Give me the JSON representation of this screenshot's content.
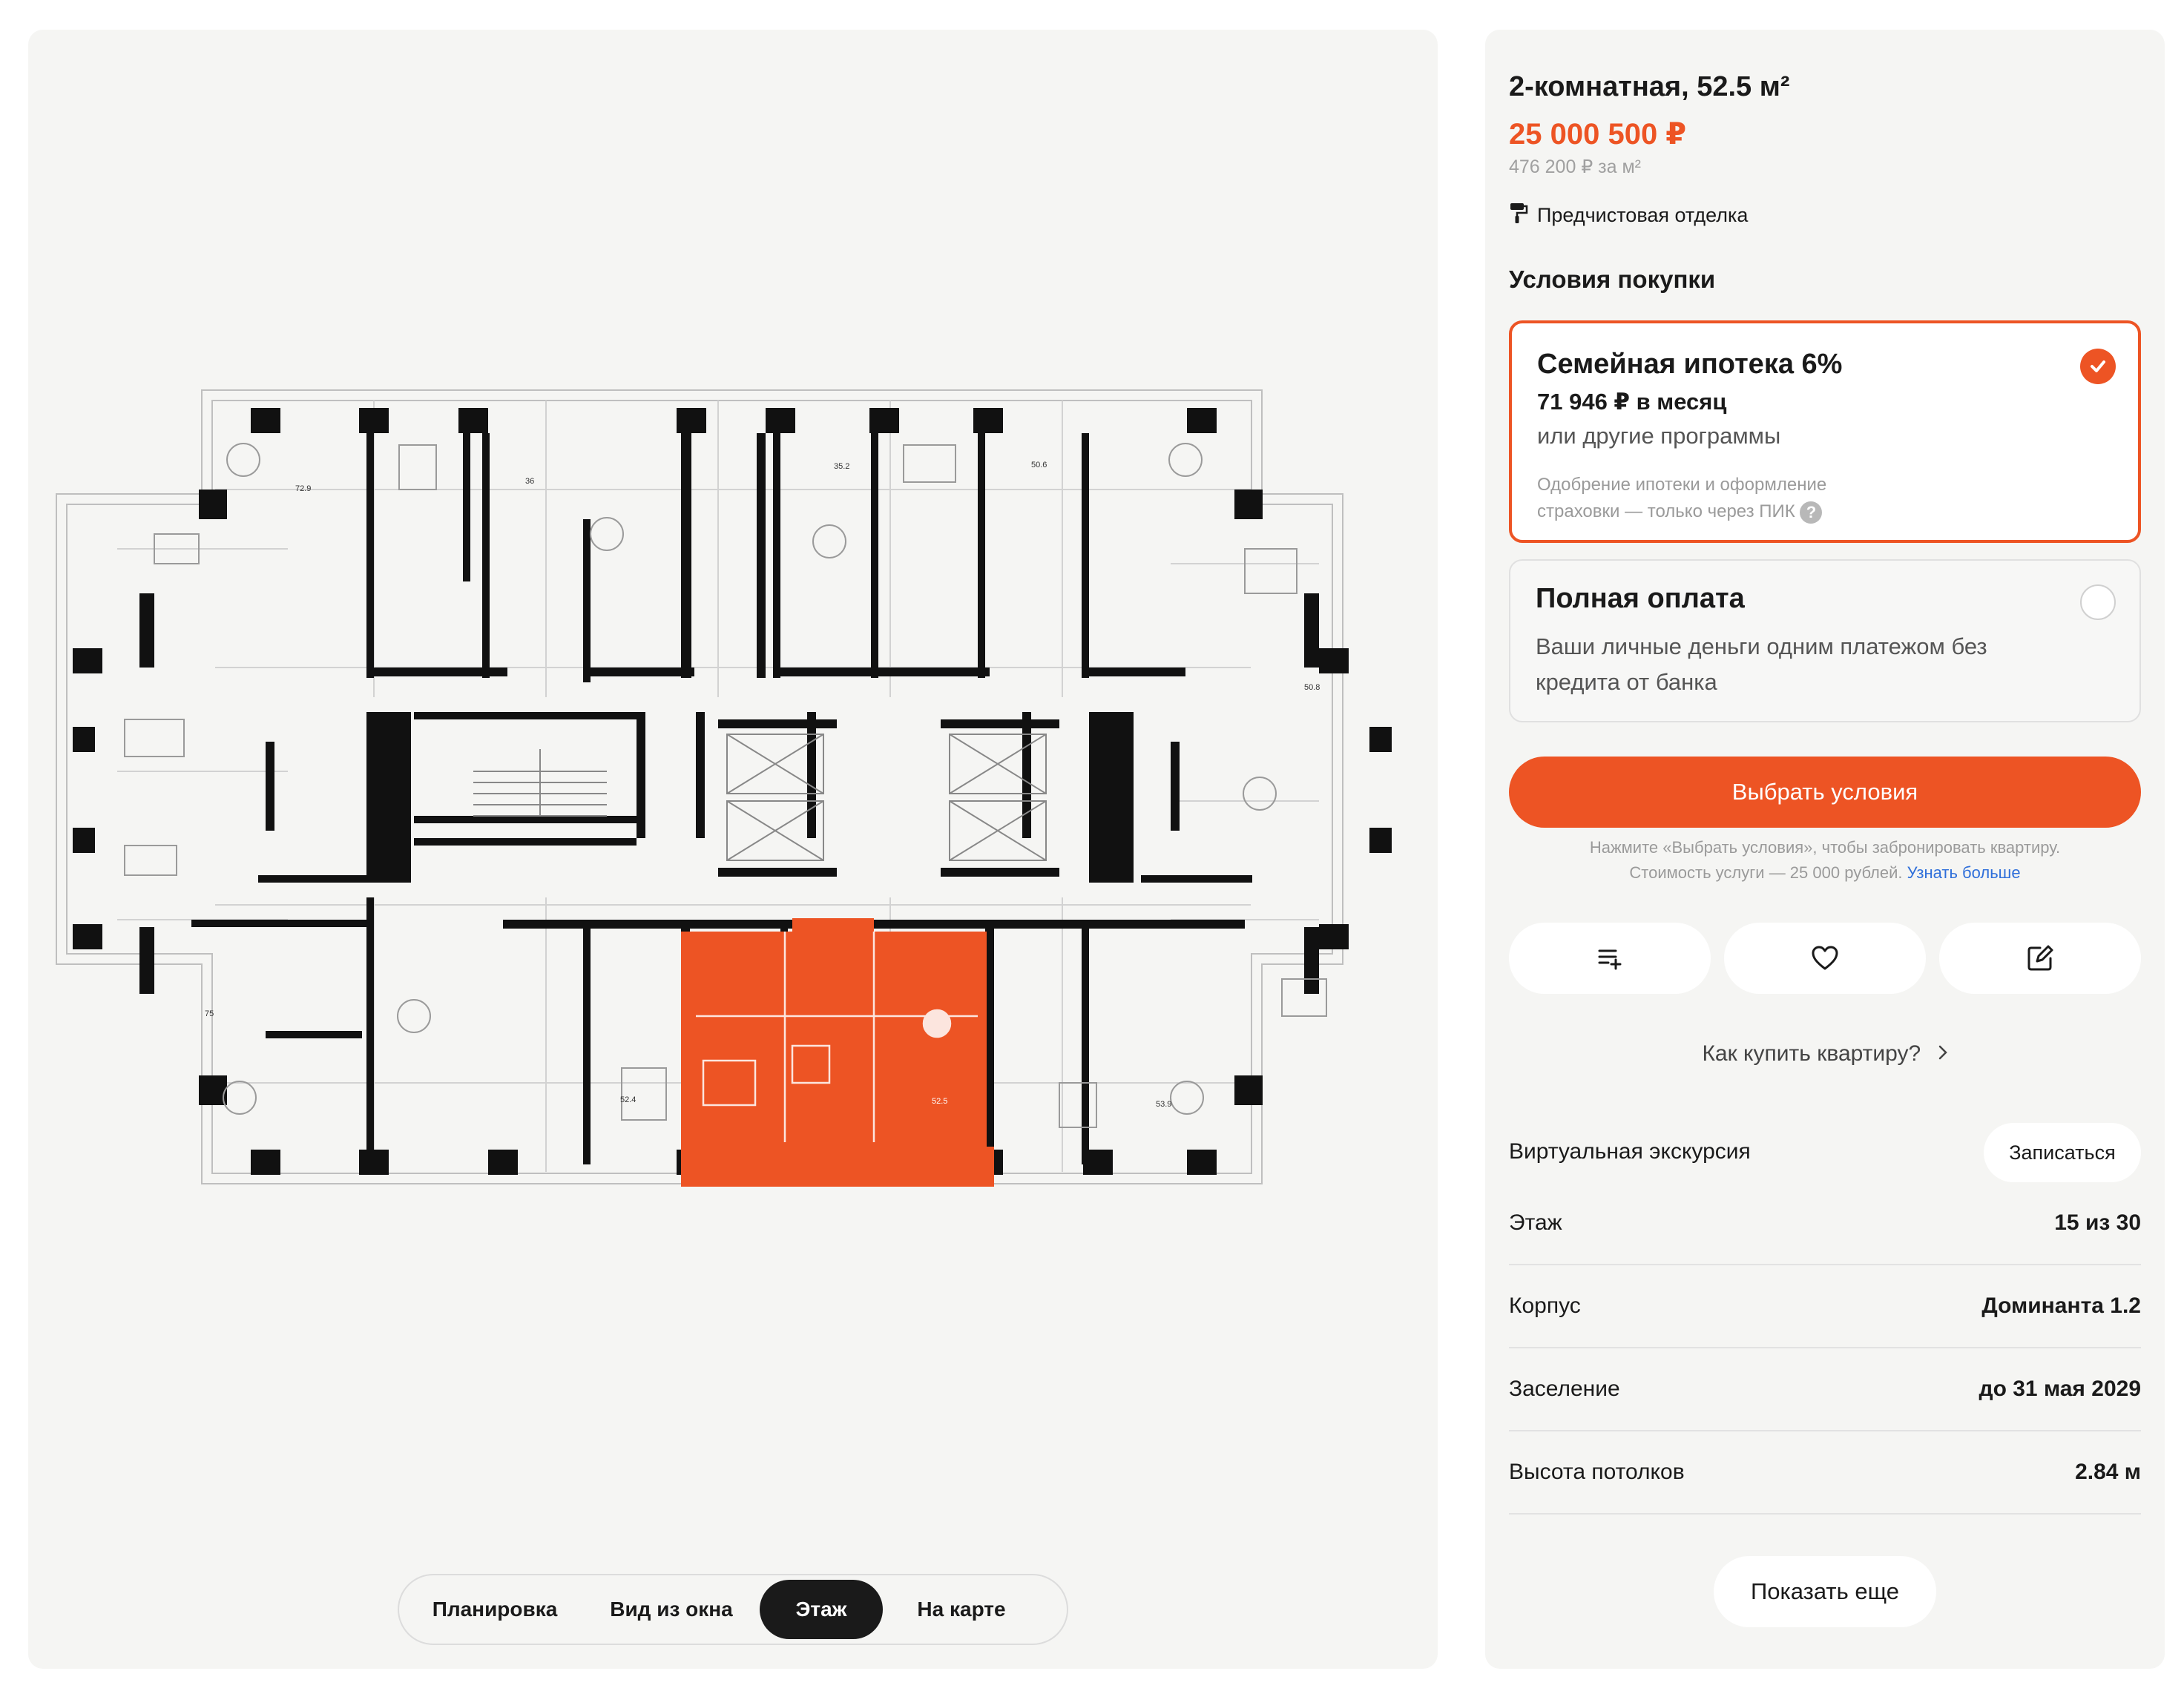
{
  "apartment": {
    "title": "2-комнатная, 52.5 м²",
    "price": "25 000 500 ₽",
    "price_per_m2": "476 200 ₽ за м²",
    "finish": "Предчистовая отделка",
    "finish_icon": "paint-roller-icon"
  },
  "purchase": {
    "heading": "Условия покупки",
    "options": [
      {
        "title": "Семейная ипотека 6%",
        "monthly": "71 946 ₽ в месяц",
        "other": "или другие программы",
        "note_line1": "Одобрение ипотеки и оформление",
        "note_line2": "страховки — только через ПИК",
        "help": "?",
        "selected": true
      },
      {
        "title": "Полная оплата",
        "desc_line1": "Ваши личные деньги одним платежом без",
        "desc_line2": "кредита от банка",
        "selected": false
      }
    ],
    "cta": "Выбрать условия",
    "cta_note_line1": "Нажмите «Выбрать условия», чтобы забронировать квартиру.",
    "cta_note_line2": "Стоимость услуги — 25 000 рублей.",
    "cta_note_link": "Узнать больше"
  },
  "actions": {
    "compare_icon": "compare-list-icon",
    "favorite_icon": "heart-icon",
    "share_icon": "edit-icon"
  },
  "howto": "Как купить квартиру?",
  "tour": {
    "label": "Виртуальная экскурсия",
    "button": "Записаться"
  },
  "details": [
    {
      "label": "Этаж",
      "value": "15 из 30"
    },
    {
      "label": "Корпус",
      "value": "Доминанта 1.2"
    },
    {
      "label": "Заселение",
      "value": "до 31 мая 2029"
    },
    {
      "label": "Высота потолков",
      "value": "2.84 м"
    }
  ],
  "more": "Показать еще",
  "view_tabs": [
    "Планировка",
    "Вид из окна",
    "Этаж",
    "На карте"
  ],
  "active_tab": "Этаж",
  "floorplan": {
    "highlight_color": "#ed5424",
    "area_labels": [
      "72.9",
      "36",
      "35.2",
      "50.6",
      "50.8",
      "75",
      "52.4",
      "52.5",
      "53.9"
    ]
  },
  "colors": {
    "accent": "#ed5424",
    "link": "#2f6fda",
    "panel": "#f5f5f3"
  }
}
